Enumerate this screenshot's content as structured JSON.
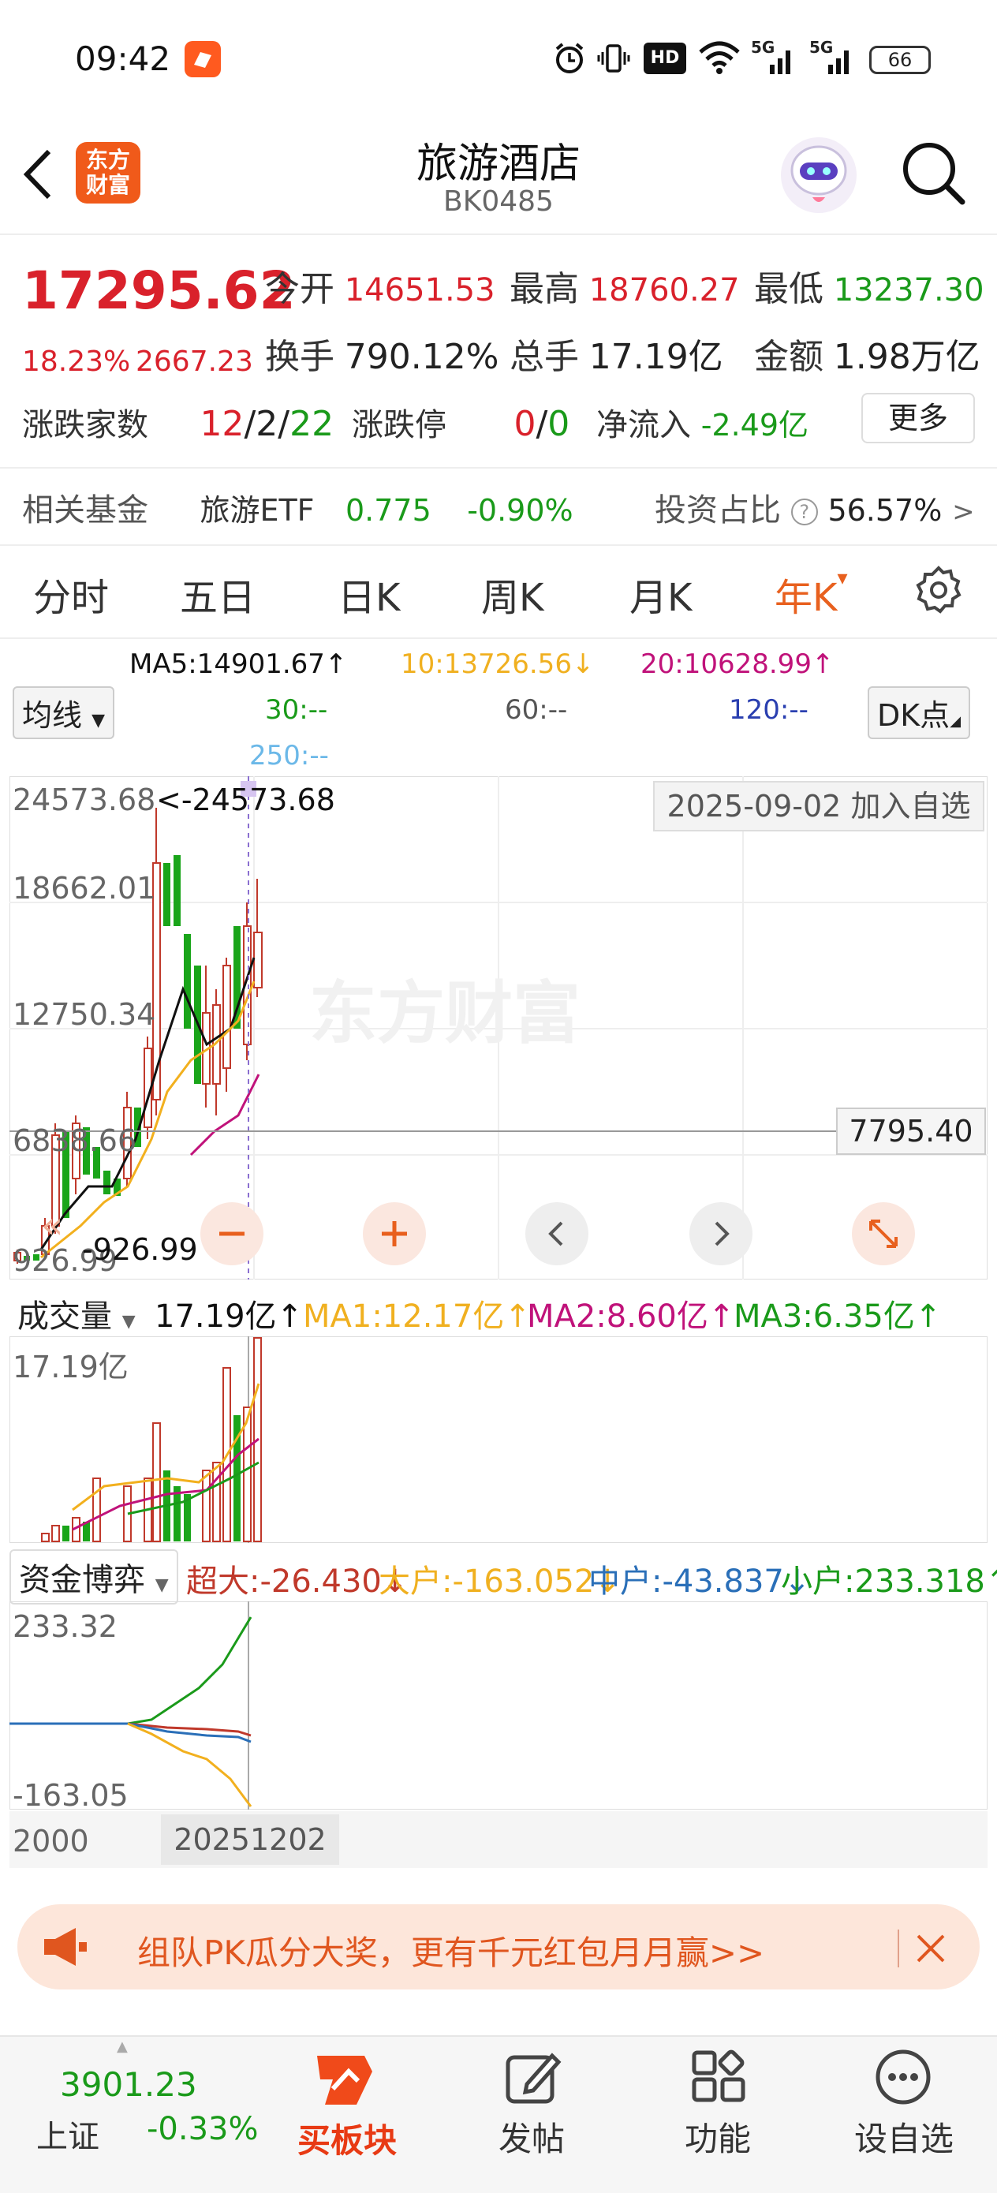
{
  "status_bar": {
    "time": "09:42",
    "battery": "66",
    "signal1": "5G",
    "signal2": "5G",
    "hd": "HD"
  },
  "header": {
    "logo_text_top": "东方",
    "logo_text_bottom": "财富",
    "title": "旅游酒店",
    "code": "BK0485"
  },
  "quote": {
    "price": "17295.62",
    "change_pct": "18.23%",
    "change_abs": "2667.23",
    "open_label": "今开",
    "open": "14651.53",
    "high_label": "最高",
    "high": "18760.27",
    "low_label": "最低",
    "low": "13237.30",
    "turnover_label": "换手",
    "turnover": "790.12%",
    "volume_label": "总手",
    "volume": "17.19亿",
    "amount_label": "金额",
    "amount": "1.98万亿",
    "breadth_label": "涨跌家数",
    "breadth_up": "12",
    "breadth_flat": "2",
    "breadth_down": "22",
    "limit_label": "涨跌停",
    "limit_up": "0",
    "limit_down": "0",
    "netflow_label": "净流入",
    "netflow": "-2.49亿",
    "more_button": "更多",
    "fund_label": "相关基金",
    "fund_name": "旅游ETF",
    "fund_price": "0.775",
    "fund_change": "-0.90%",
    "invest_ratio_label": "投资占比",
    "invest_ratio": "56.57%",
    "slash": "/",
    "chevron": ">"
  },
  "tabs": [
    {
      "label": "分时",
      "active": false
    },
    {
      "label": "五日",
      "active": false
    },
    {
      "label": "日K",
      "active": false
    },
    {
      "label": "周K",
      "active": false
    },
    {
      "label": "月K",
      "active": false
    },
    {
      "label": "年K",
      "active": true
    }
  ],
  "tab_arrow": "▾",
  "ma": {
    "ma5": "MA5:14901.67",
    "ma10": "10:13726.56",
    "ma20": "20:10628.99",
    "ma30": "30:--",
    "ma60": "60:--",
    "ma120": "120:--",
    "ma250": "250:--",
    "up_arrow": "↑",
    "down_arrow": "↓",
    "junxian": "均线",
    "dk": "DK点"
  },
  "kline": {
    "y_labels": [
      "24573.68",
      "18662.01",
      "12750.34",
      "6838.66",
      "926.99"
    ],
    "max_marker": "<-24573.68",
    "min_marker": "-926.99",
    "crosshair_value": "7795.40",
    "date_tag": "2025-09-02",
    "add_watch": "加入自选",
    "watermark": "东方财富",
    "colors": {
      "up": "#c0392b",
      "down": "#1aa51a",
      "ma5": "#111111",
      "ma10": "#f2b01e",
      "ma20": "#c0127a"
    }
  },
  "volume": {
    "select": "成交量",
    "value": "17.19亿",
    "ma1": "MA1:12.17亿",
    "ma2": "MA2:8.60亿",
    "ma3": "MA3:6.35亿",
    "top_label": "17.19亿"
  },
  "capital": {
    "select": "资金博弈",
    "super": "超大:-26.430",
    "large": "大户:-163.052",
    "mid": "中户:-43.837",
    "small": "小户:233.318",
    "top_label": "233.32",
    "bottom_label": "-163.05",
    "x_start": "2000",
    "x_end": "20251202"
  },
  "banner": {
    "text": "组队PK瓜分大奖，更有千元红包月月赢>>"
  },
  "bottom_bar": {
    "index_value": "3901.23",
    "index_name": "上证",
    "index_change": "-0.33%",
    "buy_sector": "买板块",
    "post": "发帖",
    "features": "功能",
    "set_watch": "设自选"
  }
}
